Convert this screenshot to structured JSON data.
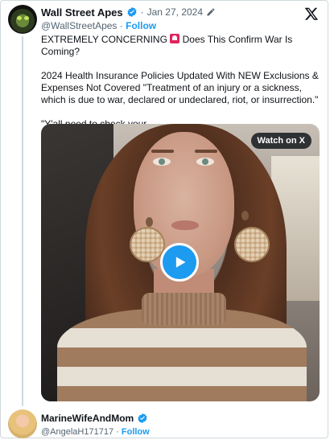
{
  "tweet": {
    "author_name": "Wall Street Apes",
    "date": "Jan 27, 2024",
    "handle": "@WallStreetApes",
    "follow_label": "Follow",
    "separator": "·",
    "headline": "EXTREMELY CONCERNING",
    "headline_tail": "Does This Confirm War Is Coming?",
    "paragraph": "2024 Health Insurance Policies Updated With NEW Exclusions & Expenses Not Covered \"Treatment of an injury or a sickness, which is due to war, declared or undeclared, riot, or insurrection.\"",
    "quote": "\"Y'all need to check your…",
    "media": {
      "watch_label": "Watch on X"
    }
  },
  "reply": {
    "author_name": "MarineWifeAndMom",
    "handle": "@AngelaH171717",
    "follow_label": "Follow",
    "separator": "·"
  },
  "colors": {
    "accent": "#1d9bf0",
    "muted": "#536471",
    "border": "#cfd9de"
  },
  "icons": [
    "verified-badge-icon",
    "edit-icon",
    "x-logo-icon",
    "siren-icon",
    "play-icon"
  ]
}
